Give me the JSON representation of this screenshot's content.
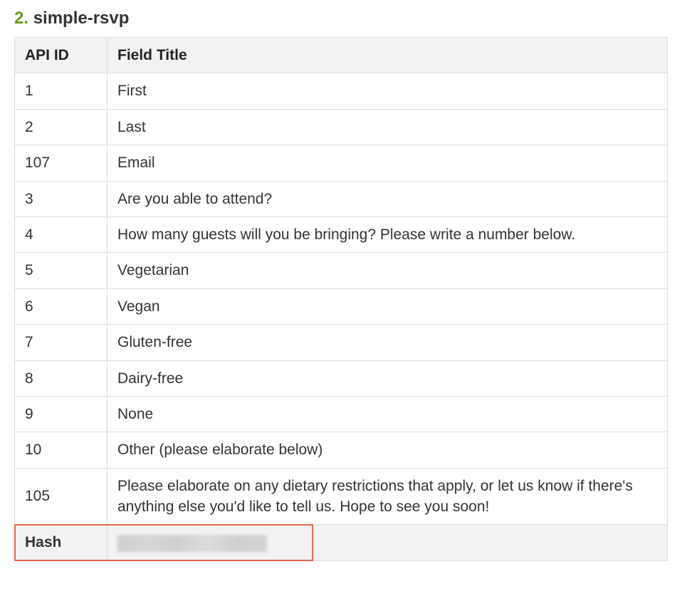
{
  "heading": {
    "number": "2.",
    "title": "simple-rsvp"
  },
  "table": {
    "headers": {
      "id": "API ID",
      "title": "Field Title"
    },
    "rows": [
      {
        "id": "1",
        "title": "First"
      },
      {
        "id": "2",
        "title": "Last"
      },
      {
        "id": "107",
        "title": "Email"
      },
      {
        "id": "3",
        "title": "Are you able to attend?"
      },
      {
        "id": "4",
        "title": "How many guests will you be bringing? Please write a number below."
      },
      {
        "id": "5",
        "title": "Vegetarian"
      },
      {
        "id": "6",
        "title": "Vegan"
      },
      {
        "id": "7",
        "title": "Gluten-free"
      },
      {
        "id": "8",
        "title": "Dairy-free"
      },
      {
        "id": "9",
        "title": "None"
      },
      {
        "id": "10",
        "title": "Other (please elaborate below)"
      },
      {
        "id": "105",
        "title": "Please elaborate on any dietary restrictions that apply, or let us know if there's anything else you'd like to tell us. Hope to see you soon!"
      }
    ],
    "hash_row": {
      "label": "Hash",
      "value_obscured": true
    }
  }
}
